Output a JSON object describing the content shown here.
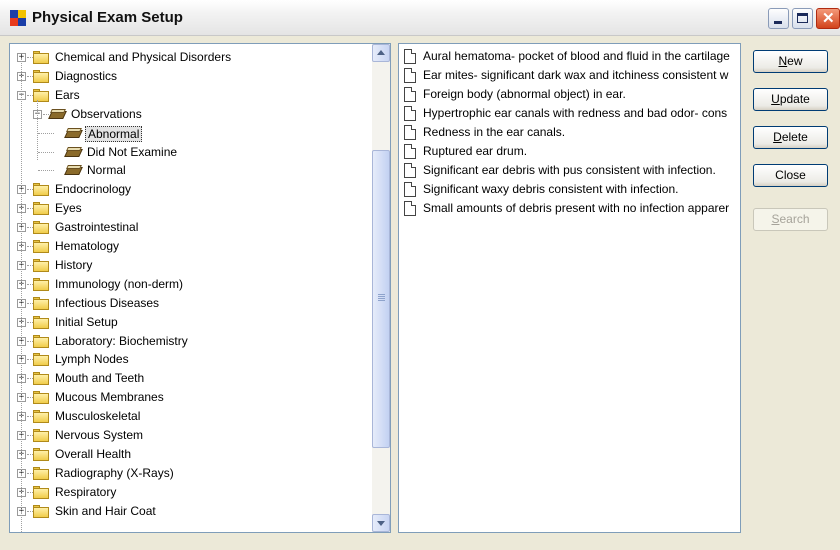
{
  "window": {
    "title": "Physical Exam Setup",
    "colors": {
      "titlebar": "#ececec",
      "client": "#ece9d8",
      "selection_border": "#333333"
    }
  },
  "tree": {
    "items": [
      {
        "label": "Chemical and Physical Disorders",
        "level": 0,
        "icon": "folder-icon",
        "expander": "+"
      },
      {
        "label": "Diagnostics",
        "level": 0,
        "icon": "folder-icon",
        "expander": "+"
      },
      {
        "label": "Ears",
        "level": 0,
        "icon": "folder-icon",
        "expander": "-"
      },
      {
        "label": "Observations",
        "level": 1,
        "icon": "book-icon",
        "expander": "-"
      },
      {
        "label": "Abnormal",
        "level": 2,
        "icon": "book-open-icon",
        "expander": "",
        "selected": true
      },
      {
        "label": "Did Not Examine",
        "level": 2,
        "icon": "book-icon",
        "expander": ""
      },
      {
        "label": "Normal",
        "level": 2,
        "icon": "book-icon",
        "expander": ""
      },
      {
        "label": "Endocrinology",
        "level": 0,
        "icon": "folder-icon",
        "expander": "+"
      },
      {
        "label": "Eyes",
        "level": 0,
        "icon": "folder-icon",
        "expander": "+"
      },
      {
        "label": "Gastrointestinal",
        "level": 0,
        "icon": "folder-icon",
        "expander": "+"
      },
      {
        "label": "Hematology",
        "level": 0,
        "icon": "folder-icon",
        "expander": "+"
      },
      {
        "label": "History",
        "level": 0,
        "icon": "folder-icon",
        "expander": "+"
      },
      {
        "label": "Immunology (non-derm)",
        "level": 0,
        "icon": "folder-icon",
        "expander": "+"
      },
      {
        "label": "Infectious Diseases",
        "level": 0,
        "icon": "folder-icon",
        "expander": "+"
      },
      {
        "label": "Initial Setup",
        "level": 0,
        "icon": "folder-icon",
        "expander": "+"
      },
      {
        "label": "Laboratory: Biochemistry",
        "level": 0,
        "icon": "folder-icon",
        "expander": "+"
      },
      {
        "label": "Lymph Nodes",
        "level": 0,
        "icon": "folder-icon",
        "expander": "+"
      },
      {
        "label": "Mouth and Teeth",
        "level": 0,
        "icon": "folder-icon",
        "expander": "+"
      },
      {
        "label": "Mucous Membranes",
        "level": 0,
        "icon": "folder-icon",
        "expander": "+"
      },
      {
        "label": "Musculoskeletal",
        "level": 0,
        "icon": "folder-icon",
        "expander": "+"
      },
      {
        "label": "Nervous System",
        "level": 0,
        "icon": "folder-icon",
        "expander": "+"
      },
      {
        "label": "Overall Health",
        "level": 0,
        "icon": "folder-icon",
        "expander": "+"
      },
      {
        "label": "Radiography (X-Rays)",
        "level": 0,
        "icon": "folder-icon",
        "expander": "+"
      },
      {
        "label": "Respiratory",
        "level": 0,
        "icon": "folder-icon",
        "expander": "+"
      },
      {
        "label": "Skin and Hair Coat",
        "level": 0,
        "icon": "folder-icon",
        "expander": "+"
      }
    ]
  },
  "observations": {
    "items": [
      "Aural hematoma- pocket of blood and fluid in the cartilage",
      "Ear mites- significant dark wax and itchiness consistent w",
      "Foreign body (abnormal object) in ear.",
      "Hypertrophic ear canals with redness and bad odor- cons",
      "Redness in the ear canals.",
      "Ruptured ear drum.",
      "Significant ear debris with pus consistent with infection.",
      "Significant waxy debris consistent with infection.",
      "Small amounts of debris present with no infection apparer"
    ]
  },
  "buttons": {
    "new": {
      "label_first": "N",
      "label_rest": "ew",
      "enabled": true
    },
    "update": {
      "label_first": "U",
      "label_rest": "pdate",
      "enabled": true
    },
    "delete": {
      "label_first": "D",
      "label_rest": "elete",
      "enabled": true
    },
    "close": {
      "label": "Close",
      "enabled": true
    },
    "search": {
      "label_first": "S",
      "label_rest": "earch",
      "enabled": false
    }
  }
}
